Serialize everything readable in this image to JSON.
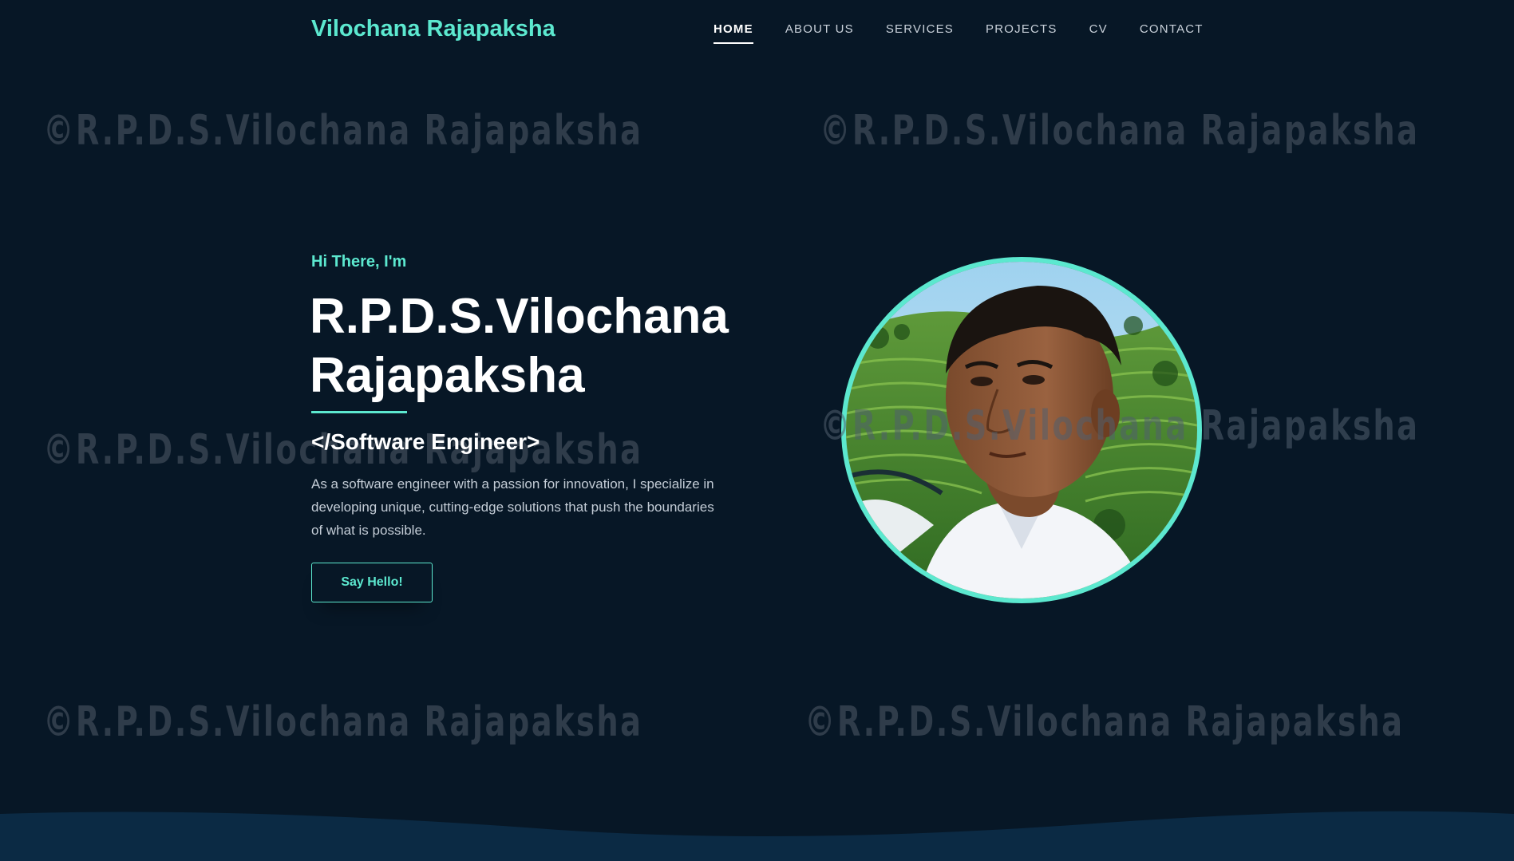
{
  "brand": "Vilochana Rajapaksha",
  "nav": {
    "items": [
      "HOME",
      "ABOUT US",
      "SERVICES",
      "PROJECTS",
      "CV",
      "CONTACT"
    ],
    "active": "HOME"
  },
  "watermark": "©R.P.D.S.Vilochana Rajapaksha",
  "hero": {
    "greeting": "Hi There, I'm",
    "name_line1": "R.P.D.S.Vilochana",
    "name_line2": "Rajapaksha",
    "role": "</Software Engineer>",
    "description": "As a software engineer with a passion for innovation, I specialize in developing unique, cutting-edge solutions that push the boundaries of what is possible.",
    "cta_label": "Say Hello!"
  },
  "profile_photo": {
    "icon": "profile-photo"
  },
  "colors": {
    "background": "#071726",
    "accent": "#5ce8cf",
    "text": "#ffffff",
    "muted_text": "#c3ccd6",
    "watermark": "#2f3c4a"
  }
}
